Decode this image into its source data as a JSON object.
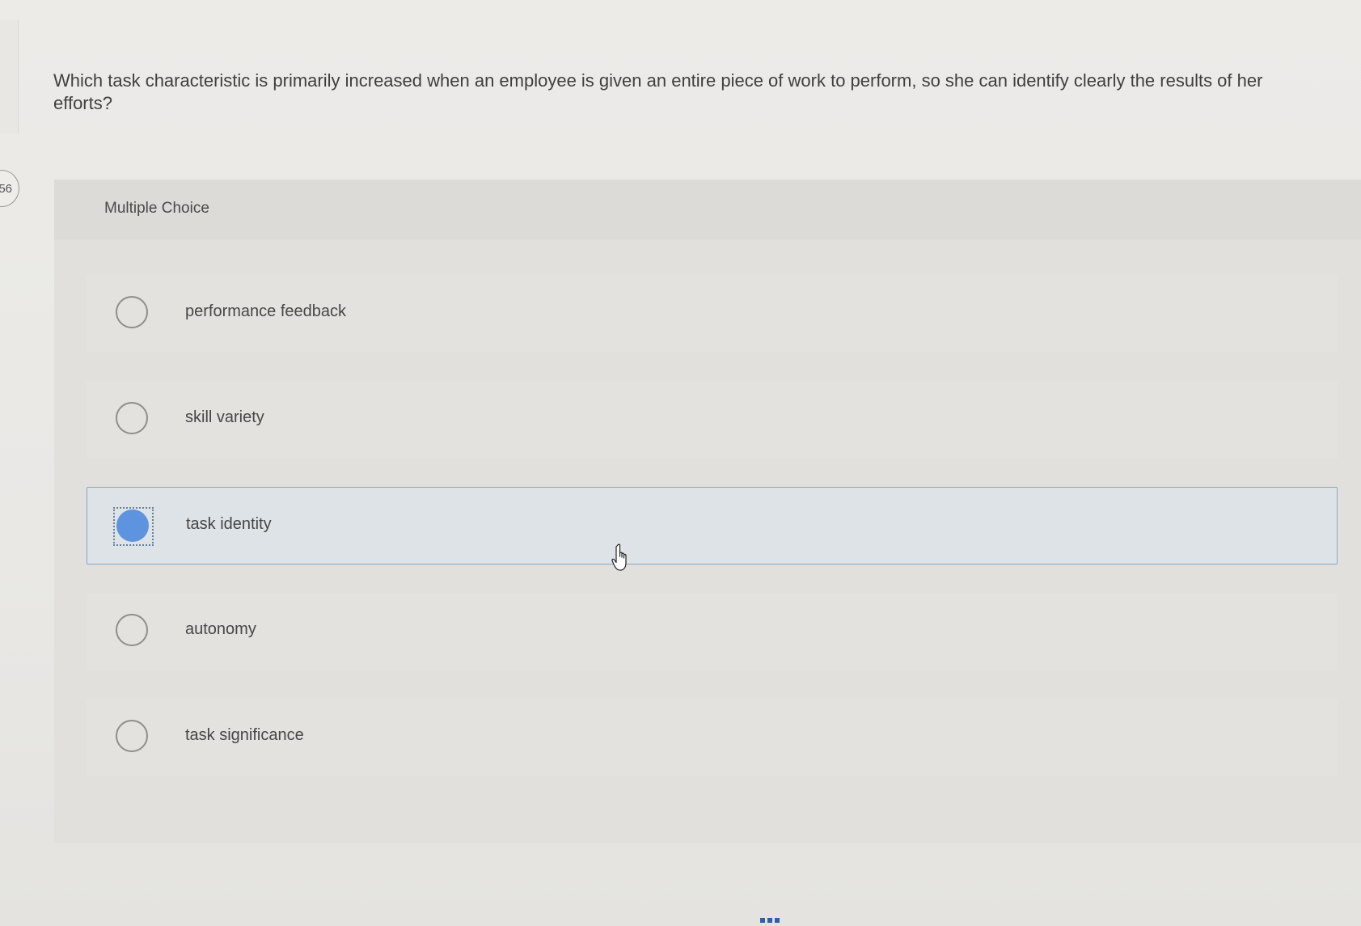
{
  "question": {
    "number_fragment": "56",
    "text": "Which task characteristic is primarily increased when an employee is given an entire piece of work to perform, so she can identify clearly the results of her efforts?"
  },
  "panel": {
    "title": "Multiple Choice"
  },
  "options": [
    {
      "label": "performance feedback",
      "selected": false
    },
    {
      "label": "skill variety",
      "selected": false
    },
    {
      "label": "task identity",
      "selected": true
    },
    {
      "label": "autonomy",
      "selected": false
    },
    {
      "label": "task significance",
      "selected": false
    }
  ],
  "colors": {
    "selected_radio": "#5d93df",
    "selected_border": "#8aa7c2"
  },
  "icons": {
    "cursor": "hand-pointer-icon"
  }
}
